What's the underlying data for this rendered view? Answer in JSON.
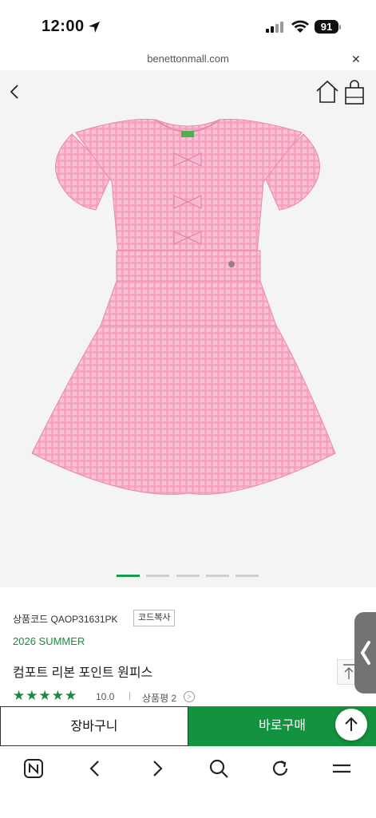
{
  "status": {
    "time": "12:00",
    "battery": "91"
  },
  "browser": {
    "url": "benettonmall.com",
    "close_label": "✕"
  },
  "nav": {
    "back_icon": "chevron-left-icon",
    "home_icon": "home-icon",
    "bag_icon": "shopping-bag-icon"
  },
  "gallery": {
    "total": 5,
    "active_index": 0
  },
  "product": {
    "code_label": "상품코드 QAOP31631PK",
    "copy_label": "코드복사",
    "season": "2026 SUMMER",
    "name": "컴포트 리본 포인트 원피스",
    "stars": "★★★★★",
    "rating": "10.0",
    "separator": "|",
    "reviews_label": "상품평 2",
    "review_chevron": ">"
  },
  "actions": {
    "cart_label": "장바구니",
    "buy_label": "바로구매"
  },
  "colors": {
    "accent_green": "#13923f",
    "season_green": "#1a8a3c",
    "dress_pink": "#f6a9c6"
  }
}
